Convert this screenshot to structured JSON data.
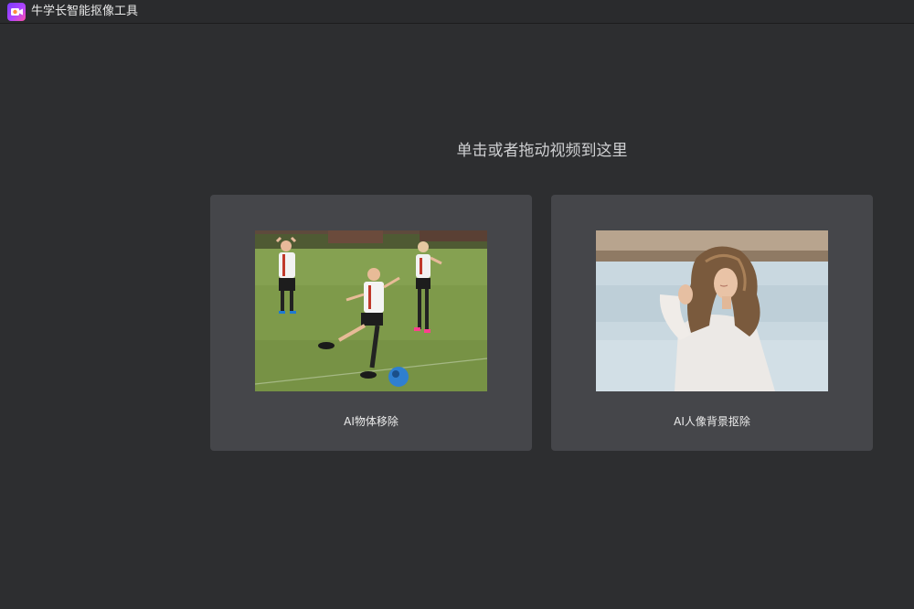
{
  "window": {
    "app_icon": "video-camera-icon",
    "title": "牛学长智能抠像工具"
  },
  "main": {
    "drop_hint": "单击或者拖动视频到这里",
    "options": [
      {
        "label": "AI物体移除",
        "image": "kids-soccer-photo"
      },
      {
        "label": "AI人像背景抠除",
        "image": "woman-portrait-photo"
      }
    ]
  }
}
